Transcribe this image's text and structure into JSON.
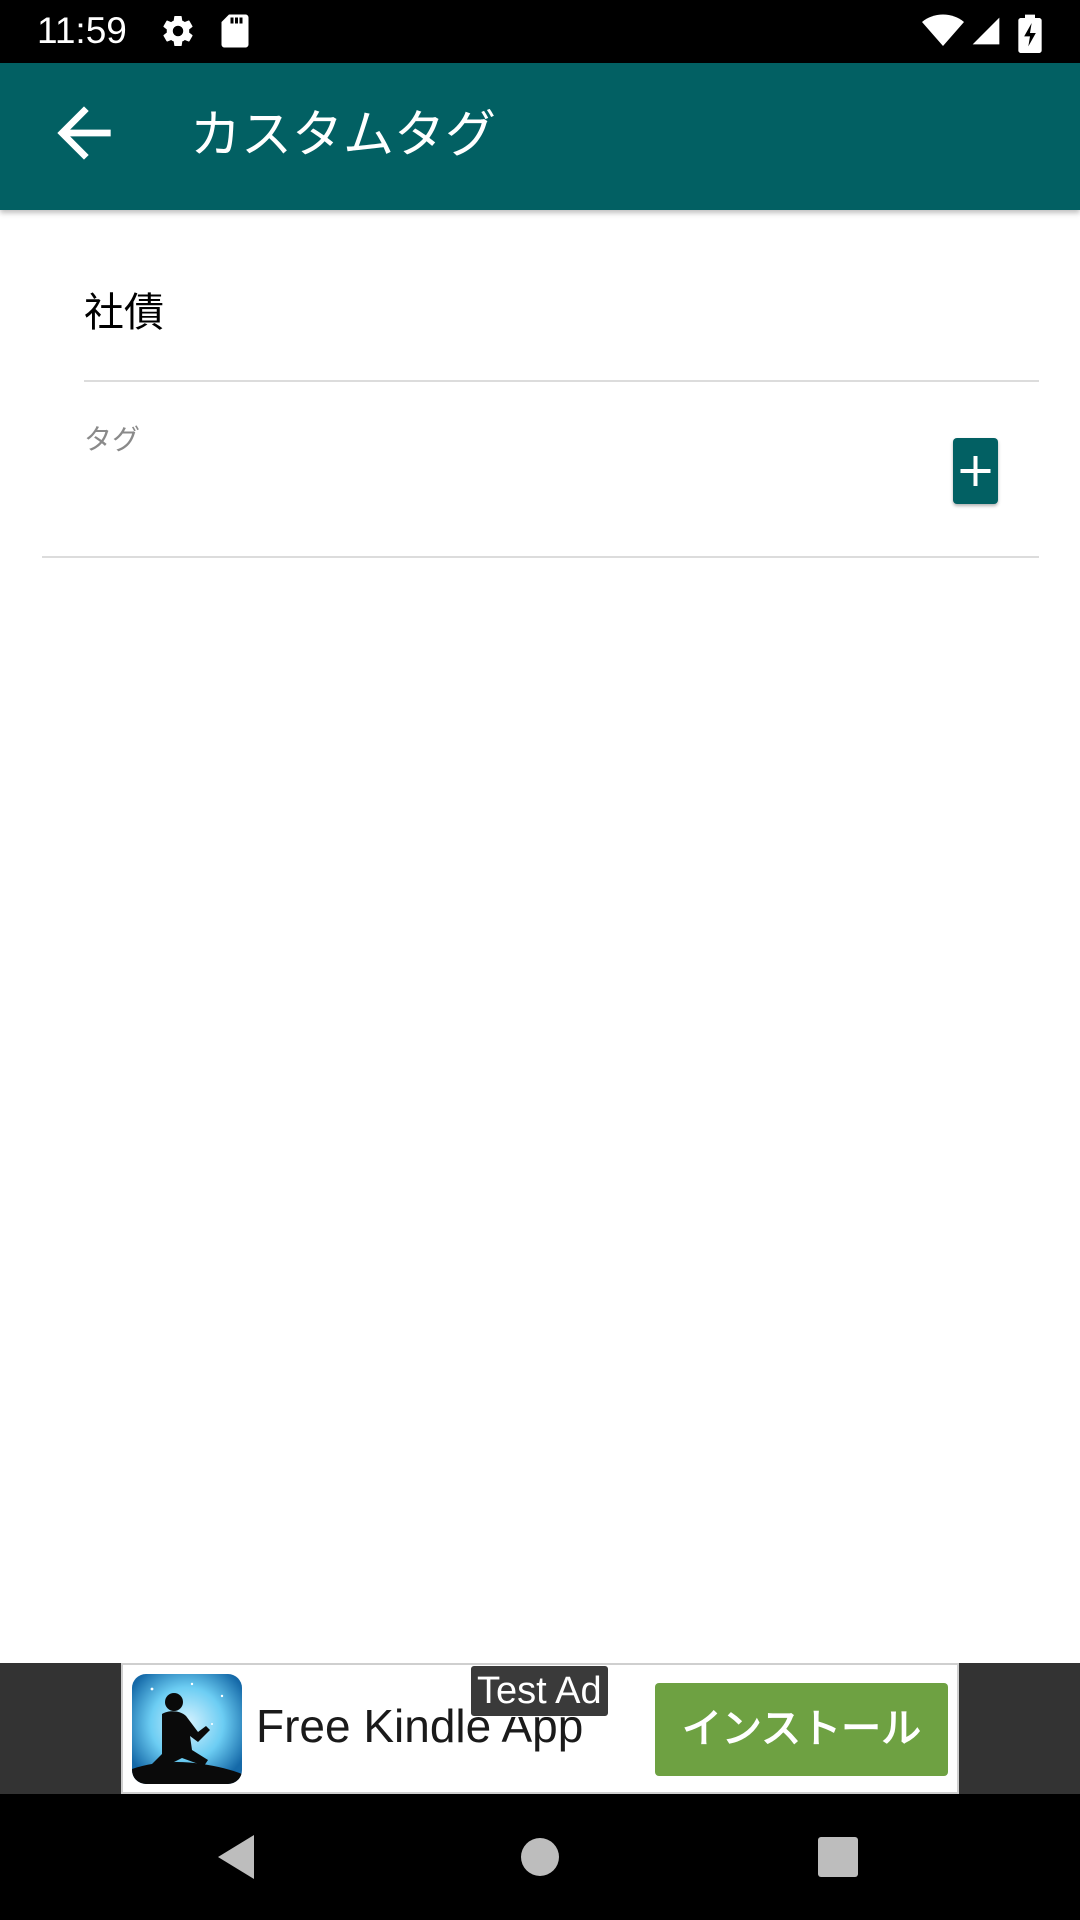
{
  "status_bar": {
    "time": "11:59",
    "icons": [
      "gear-icon",
      "sd-card-icon",
      "wifi-icon",
      "signal-icon",
      "battery-charging-icon"
    ]
  },
  "app_bar": {
    "title": "カスタムタグ",
    "back_icon": "arrow-back-icon",
    "background_color": "#026063"
  },
  "form": {
    "name_value": "社債",
    "tag_label": "タグ",
    "add_icon": "plus-icon"
  },
  "ad": {
    "app_name": "Free Kindle App",
    "test_badge": "Test Ad",
    "install_label": "インストール",
    "install_color": "#6ea142"
  },
  "nav_bar": {
    "buttons": [
      "back-triangle-icon",
      "home-circle-icon",
      "recents-square-icon"
    ]
  }
}
